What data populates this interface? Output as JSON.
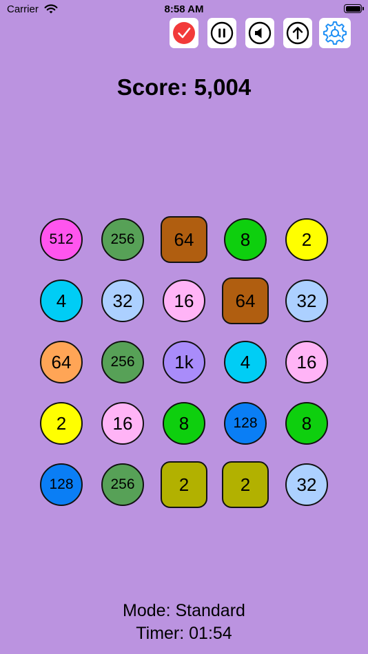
{
  "status_bar": {
    "carrier": "Carrier",
    "time": "8:58 AM"
  },
  "toolbar": {
    "buttons": [
      {
        "name": "check-icon"
      },
      {
        "name": "pause-icon"
      },
      {
        "name": "sound-icon"
      },
      {
        "name": "up-arrow-icon"
      },
      {
        "name": "gear-icon"
      }
    ]
  },
  "score": {
    "label": "Score: 5,004"
  },
  "board": {
    "rows": [
      [
        {
          "v": "512",
          "c": "#ff55ee",
          "s": "circle"
        },
        {
          "v": "256",
          "c": "#57a157",
          "s": "circle"
        },
        {
          "v": "64",
          "c": "#b05e10",
          "s": "square"
        },
        {
          "v": "8",
          "c": "#0ecf0e",
          "s": "circle"
        },
        {
          "v": "2",
          "c": "#ffff00",
          "s": "circle"
        }
      ],
      [
        {
          "v": "4",
          "c": "#00cdf5",
          "s": "circle"
        },
        {
          "v": "32",
          "c": "#acd0ff",
          "s": "circle"
        },
        {
          "v": "16",
          "c": "#ffb4f6",
          "s": "circle"
        },
        {
          "v": "64",
          "c": "#b05e10",
          "s": "square"
        },
        {
          "v": "32",
          "c": "#acd0ff",
          "s": "circle"
        }
      ],
      [
        {
          "v": "64",
          "c": "#ffa556",
          "s": "circle"
        },
        {
          "v": "256",
          "c": "#57a157",
          "s": "circle"
        },
        {
          "v": "1k",
          "c": "#a98cfa",
          "s": "circle"
        },
        {
          "v": "4",
          "c": "#00cdf5",
          "s": "circle"
        },
        {
          "v": "16",
          "c": "#ffb4f6",
          "s": "circle"
        }
      ],
      [
        {
          "v": "2",
          "c": "#ffff00",
          "s": "circle"
        },
        {
          "v": "16",
          "c": "#ffb4f6",
          "s": "circle"
        },
        {
          "v": "8",
          "c": "#0ecf0e",
          "s": "circle"
        },
        {
          "v": "128",
          "c": "#0a7ef5",
          "s": "circle"
        },
        {
          "v": "8",
          "c": "#0ecf0e",
          "s": "circle"
        }
      ],
      [
        {
          "v": "128",
          "c": "#0a7ef5",
          "s": "circle"
        },
        {
          "v": "256",
          "c": "#57a157",
          "s": "circle"
        },
        {
          "v": "2",
          "c": "#b2b100",
          "s": "square"
        },
        {
          "v": "2",
          "c": "#b2b100",
          "s": "square"
        },
        {
          "v": "32",
          "c": "#acd0ff",
          "s": "circle"
        }
      ]
    ]
  },
  "footer": {
    "mode": "Mode: Standard",
    "timer": "Timer: 01:54"
  },
  "colors": {
    "background": "#bb93e0",
    "check_red": "#f23a3a",
    "gear_blue": "#1c8ef5"
  }
}
